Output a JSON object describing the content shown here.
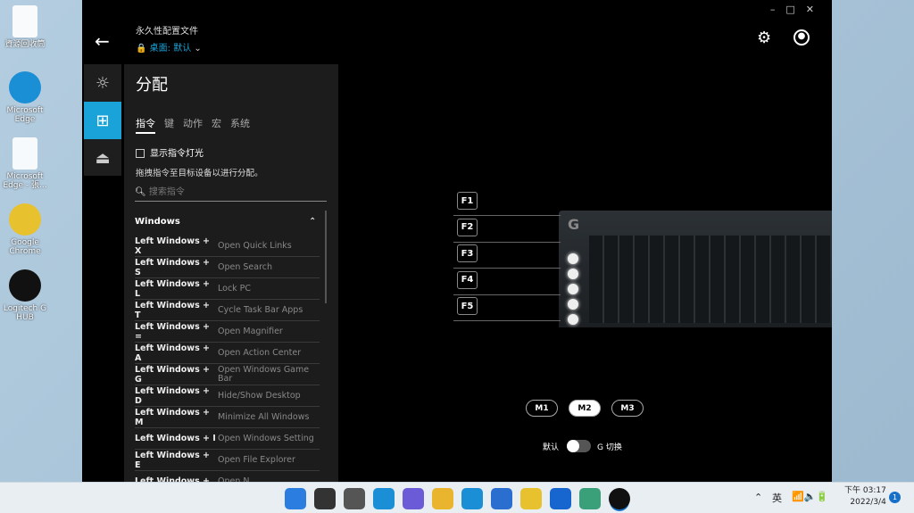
{
  "desktop": {
    "icons": [
      {
        "label": "資源回收筒",
        "icon": "recycle-bin-icon"
      },
      {
        "label": "Microsoft Edge",
        "icon": "edge-icon"
      },
      {
        "label": "Microsoft Edge - 張...",
        "icon": "file-icon"
      },
      {
        "label": "Google Chrome",
        "icon": "chrome-icon"
      },
      {
        "label": "Logitech G HUB",
        "icon": "logitech-g-icon"
      }
    ]
  },
  "header": {
    "profile_label": "永久性配置文件",
    "profile_value": "桌面: 默认"
  },
  "nav": [
    "brightness-icon",
    "assign-icon",
    "game-mode-icon"
  ],
  "panel": {
    "title": "分配",
    "tabs": [
      "指令",
      "键",
      "动作",
      "宏",
      "系统"
    ],
    "checkbox_label": "显示指令灯光",
    "hint": "拖拽指令至目标设备以进行分配。",
    "search_placeholder": "搜索指令",
    "section": "Windows",
    "rows": [
      {
        "key": "Left Windows + X",
        "desc": "Open Quick Links"
      },
      {
        "key": "Left Windows + S",
        "desc": "Open Search"
      },
      {
        "key": "Left Windows + L",
        "desc": "Lock PC"
      },
      {
        "key": "Left Windows + T",
        "desc": "Cycle Task Bar Apps"
      },
      {
        "key": "Left Windows + =",
        "desc": "Open Magnifier"
      },
      {
        "key": "Left Windows + A",
        "desc": "Open Action Center"
      },
      {
        "key": "Left Windows + G",
        "desc": "Open Windows Game Bar"
      },
      {
        "key": "Left Windows + D",
        "desc": "Hide/Show Desktop"
      },
      {
        "key": "Left Windows + M",
        "desc": "Minimize All Windows"
      },
      {
        "key": "Left Windows + I",
        "desc": "Open Windows Setting"
      },
      {
        "key": "Left Windows + E",
        "desc": "Open File Explorer"
      },
      {
        "key": "Left Windows +",
        "desc": "Open N..."
      }
    ]
  },
  "gkeys": [
    "F1",
    "F2",
    "F3",
    "F4",
    "F5"
  ],
  "modes": {
    "items": [
      "M1",
      "M2",
      "M3"
    ],
    "selected": "M2"
  },
  "toggle": {
    "left": "默认",
    "right": "G 切换",
    "on": false
  },
  "taskbar": {
    "lang": "英",
    "time": "下午 03:17",
    "date": "2022/3/4",
    "notifications": "1"
  },
  "colors": {
    "accent": "#1aa3d9",
    "profile": "#1aa3d9"
  }
}
